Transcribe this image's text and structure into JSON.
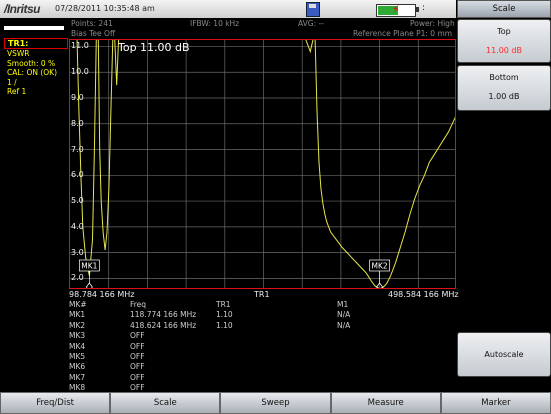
{
  "header": {
    "logo": "/Inritsu",
    "datetime": "07/28/2011 10:35:48 am",
    "battery_level": 0.55,
    "battery_indicator": ":"
  },
  "info_bar": {
    "points": "Points: 241",
    "bias_tee": "Bias Tee Off",
    "ifbw": "IFBW: 10 kHz",
    "avg": "AVG: --",
    "power": "Power: High",
    "ref_plane": "Reference Plane P1: 0 mm"
  },
  "trace_panel": {
    "title": "TR1:",
    "lines": [
      "VSWR",
      "Smooth: 0 %",
      "CAL: ON (OK)",
      "1 /",
      "Ref 1"
    ]
  },
  "plot": {
    "title": "Top 11.00 dB",
    "y_ticks": [
      "11.0",
      "10.0",
      "9.0",
      "8.0",
      "7.0",
      "6.0",
      "5.0",
      "4.0",
      "3.0",
      "2.0"
    ],
    "start_freq": "98.784 166 MHz",
    "stop_freq": "498.584 166 MHz",
    "trace_label": "TR1",
    "mk1": "MK1",
    "mk2": "MK2"
  },
  "chart_data": {
    "type": "line",
    "xlabel": "",
    "ylabel": "",
    "xlim": [
      98.784,
      498.584
    ],
    "ylim": [
      1.55,
      11.25
    ],
    "series": [
      {
        "x": [
          98.8,
          103,
          106,
          108,
          110,
          112,
          115,
          118.8,
          122,
          124,
          126,
          128,
          129.5,
          131,
          133,
          135,
          137,
          139,
          141,
          143,
          145,
          147,
          149,
          152,
          160,
          200,
          300,
          342,
          347,
          350,
          352,
          354,
          356,
          358,
          360,
          362,
          364,
          366,
          368,
          372,
          376,
          380,
          385,
          390,
          395,
          400,
          405,
          410,
          414,
          418.6,
          422,
          426,
          430,
          435,
          440,
          445,
          450,
          455,
          460,
          465,
          470,
          475,
          480,
          485,
          490,
          495,
          498.6
        ],
        "y": [
          11.3,
          11.3,
          11.3,
          8.5,
          6.0,
          4.0,
          2.8,
          2.1,
          3.5,
          7.0,
          11.3,
          11.3,
          7.0,
          5.0,
          3.8,
          3.1,
          3.8,
          5.5,
          8.5,
          11.3,
          11.3,
          9.5,
          11.3,
          11.3,
          11.3,
          11.3,
          11.3,
          11.3,
          10.8,
          11.3,
          11.3,
          8.5,
          6.5,
          5.5,
          4.9,
          4.5,
          4.2,
          4.0,
          3.8,
          3.6,
          3.4,
          3.2,
          3.0,
          2.8,
          2.6,
          2.4,
          2.2,
          1.9,
          1.7,
          1.6,
          1.65,
          1.8,
          2.1,
          2.6,
          3.2,
          3.8,
          4.5,
          5.1,
          5.6,
          6.0,
          6.5,
          6.8,
          7.1,
          7.4,
          7.7,
          8.1,
          8.4
        ]
      }
    ],
    "markers": [
      {
        "name": "MK1",
        "x": 118.774166,
        "y": 1.1
      },
      {
        "name": "MK2",
        "x": 418.624166,
        "y": 1.1
      }
    ]
  },
  "marker_table": {
    "header": {
      "c1": "MK#",
      "c2": "Freq",
      "c3": "TR1",
      "c4": "M1"
    },
    "rows": [
      {
        "c1": "MK1",
        "c2": "118.774 166 MHz",
        "c3": "1.10",
        "c4": "N/A"
      },
      {
        "c1": "MK2",
        "c2": "418.624 166 MHz",
        "c3": "1.10",
        "c4": "N/A"
      },
      {
        "c1": "MK3",
        "c2": "OFF",
        "c3": "",
        "c4": ""
      },
      {
        "c1": "MK4",
        "c2": "OFF",
        "c3": "",
        "c4": ""
      },
      {
        "c1": "MK5",
        "c2": "OFF",
        "c3": "",
        "c4": ""
      },
      {
        "c1": "MK6",
        "c2": "OFF",
        "c3": "",
        "c4": ""
      },
      {
        "c1": "MK7",
        "c2": "OFF",
        "c3": "",
        "c4": ""
      },
      {
        "c1": "MK8",
        "c2": "OFF",
        "c3": "",
        "c4": ""
      }
    ]
  },
  "side_menu": {
    "title": "Scale",
    "top_label": "Top",
    "top_value": "11.00 dB",
    "bottom_label": "Bottom",
    "bottom_value": "1.00 dB",
    "autoscale": "Autoscale"
  },
  "bottom_menu": [
    "Freq/Dist",
    "Scale",
    "Sweep",
    "Measure",
    "Marker"
  ],
  "colors": {
    "trace": "#e6e64a",
    "top_value": "#ff2a2a",
    "trace_text": "#ffff00",
    "frame": "#dd1111"
  }
}
